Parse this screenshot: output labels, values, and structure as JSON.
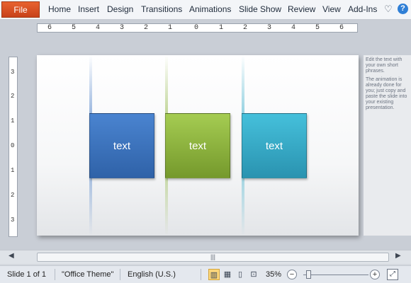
{
  "ribbon": {
    "file_label": "File",
    "tabs": [
      "Home",
      "Insert",
      "Design",
      "Transitions",
      "Animations",
      "Slide Show",
      "Review",
      "View",
      "Add-Ins"
    ],
    "icons": [
      "chevron-heart-icon",
      "help-icon"
    ]
  },
  "ruler": {
    "horizontal": [
      "6",
      "5",
      "4",
      "3",
      "2",
      "1",
      "0",
      "1",
      "2",
      "3",
      "4",
      "5",
      "6"
    ],
    "vertical": [
      "3",
      "2",
      "1",
      "0",
      "1",
      "2",
      "3"
    ]
  },
  "slide": {
    "boxes": [
      {
        "label": "text",
        "color": "#3f77c4"
      },
      {
        "label": "text",
        "color": "#8cb43c"
      },
      {
        "label": "text",
        "color": "#35acc9"
      }
    ]
  },
  "notes": {
    "lines": [
      "Edit the text with your own short phrases.",
      "The animation is already done for you; just copy and paste the slide into your existing presentation."
    ]
  },
  "scrollbar": {
    "grip": "|||"
  },
  "status": {
    "slide": "Slide 1 of 1",
    "theme": "\"Office Theme\"",
    "language": "English (U.S.)",
    "zoom": "35%",
    "zoom_minus": "−",
    "zoom_plus": "+"
  }
}
